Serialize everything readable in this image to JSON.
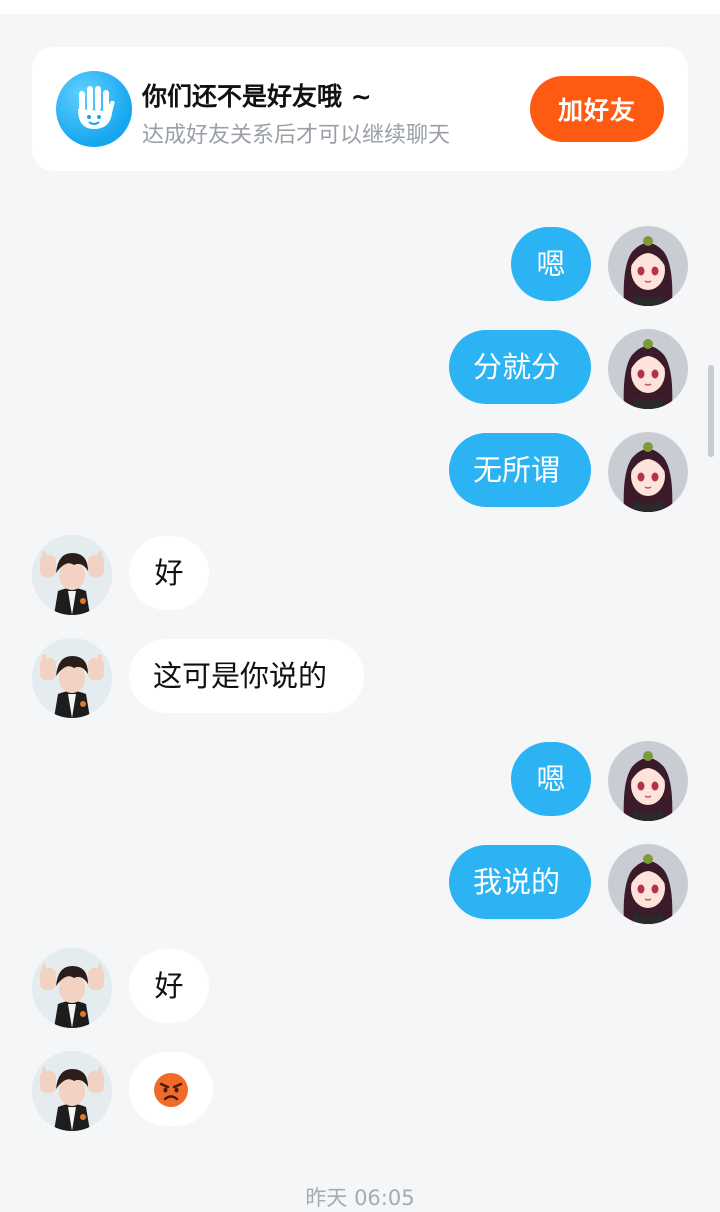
{
  "banner": {
    "title": "你们还不是好友哦 ~",
    "subtitle": "达成好友关系后才可以继续聊天",
    "add_button": "加好友",
    "icon": "waving-hand-icon"
  },
  "colors": {
    "outgoing_bubble": "#2cb3f3",
    "incoming_bubble": "#ffffff",
    "add_button": "#ff5a12",
    "background": "#f4f6f8"
  },
  "messages": [
    {
      "side": "me",
      "text": "嗯"
    },
    {
      "side": "me",
      "text": "分就分"
    },
    {
      "side": "me",
      "text": "无所谓"
    },
    {
      "side": "peer",
      "text": "好"
    },
    {
      "side": "peer",
      "text": "这可是你说的"
    },
    {
      "side": "me",
      "text": "嗯"
    },
    {
      "side": "me",
      "text": "我说的"
    },
    {
      "side": "peer",
      "text": "好"
    },
    {
      "side": "peer",
      "text": "",
      "emoji": "angry-face-emoji"
    }
  ],
  "timestamp": "昨天 06:05"
}
